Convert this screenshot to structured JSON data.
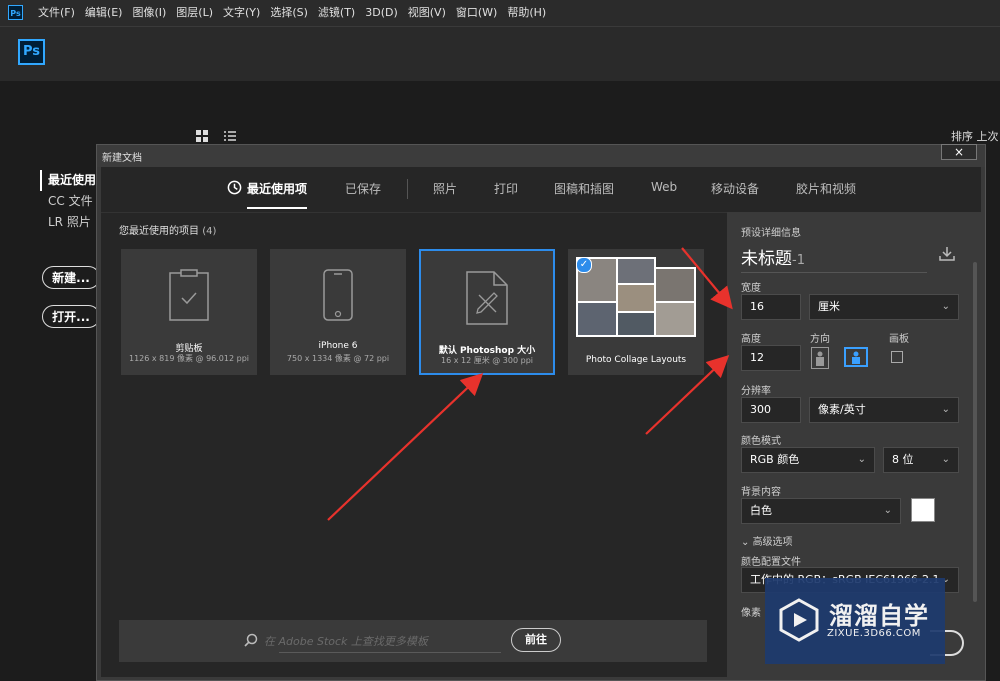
{
  "menubar": {
    "logo": "Ps",
    "items": [
      "文件(F)",
      "编辑(E)",
      "图像(I)",
      "图层(L)",
      "文字(Y)",
      "选择(S)",
      "滤镜(T)",
      "3D(D)",
      "视图(V)",
      "窗口(W)",
      "帮助(H)"
    ]
  },
  "home": {
    "logo": "Ps",
    "nav": [
      "最近使用",
      "CC 文件",
      "LR 照片"
    ],
    "new_button": "新建...",
    "open_button": "打开...",
    "sort_label": "排序 上次"
  },
  "dialog": {
    "title": "新建文档",
    "close": "×",
    "tabs": [
      "最近使用项",
      "已保存",
      "照片",
      "打印",
      "图稿和插图",
      "Web",
      "移动设备",
      "胶片和视频"
    ],
    "recent_label": "您最近使用的项目",
    "recent_count": "(4)",
    "presets": [
      {
        "name": "剪贴板",
        "desc": "1126 x 819 像素 @ 96.012 ppi"
      },
      {
        "name": "iPhone 6",
        "desc": "750 x 1334 像素 @ 72 ppi"
      },
      {
        "name": "默认 Photoshop 大小",
        "desc": "16 x 12 厘米 @ 300 ppi"
      },
      {
        "name": "Photo Collage Layouts",
        "desc": ""
      }
    ],
    "stock_placeholder": "在 Adobe Stock 上查找更多模板",
    "go_button": "前往",
    "details": {
      "section_label": "预设详细信息",
      "doc_name": "未标题",
      "doc_suffix": "-1",
      "width_label": "宽度",
      "width_value": "16",
      "width_unit": "厘米",
      "height_label": "高度",
      "height_value": "12",
      "orientation_label": "方向",
      "artboard_label": "画板",
      "resolution_label": "分辨率",
      "resolution_value": "300",
      "resolution_unit": "像素/英寸",
      "color_mode_label": "颜色模式",
      "color_mode_value": "RGB 颜色",
      "bit_depth": "8 位",
      "background_label": "背景内容",
      "background_value": "白色",
      "advanced_label": "高级选项",
      "color_profile_label": "颜色配置文件",
      "color_profile_value": "工作中的 RGB：sRGB IEC61966-2.1",
      "pixel_ratio_label": "像素"
    }
  },
  "watermark": {
    "text": "溜溜自学",
    "url": "ZIXUE.3D66.COM"
  },
  "colors": {
    "accent": "#2d8ceb",
    "ps_blue": "#31a8ff",
    "arrow": "#e8322c"
  }
}
